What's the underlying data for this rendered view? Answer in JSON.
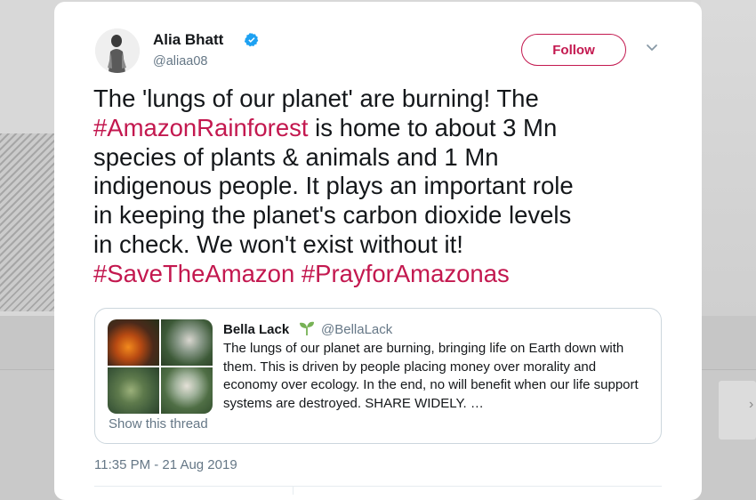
{
  "tweet": {
    "author_name": "Alia Bhatt",
    "author_handle": "@aliaa08",
    "follow_label": "Follow",
    "text_parts": [
      {
        "text": "The 'lungs of our planet' are burning! The\n",
        "type": "text"
      },
      {
        "text": "#AmazonRainforest",
        "type": "hashtag"
      },
      {
        "text": " is home to about 3 Mn\nspecies of plants & animals and 1 Mn\nindigenous people. It plays an important role\nin keeping the planet's carbon dioxide levels\nin check. We won't exist without it!\n",
        "type": "text"
      },
      {
        "text": "#SaveTheAmazon",
        "type": "hashtag"
      },
      {
        "text": " ",
        "type": "text"
      },
      {
        "text": "#PrayforAmazonas",
        "type": "hashtag"
      }
    ],
    "timestamp": "11:35 PM - 21 Aug 2019"
  },
  "quoted": {
    "author_name": "Bella Lack",
    "author_handle": "@BellaLack",
    "text": "The lungs of our planet are burning, bringing life on Earth down with them. This is driven by people placing money over morality and economy over ecology. In the end, no will benefit when our life support systems are destroyed. SHARE WIDELY. …",
    "show_thread_label": "Show this thread"
  },
  "icons": {
    "verified": "verified-badge-icon",
    "caret": "chevron-down-icon",
    "sprout": "seedling-icon"
  },
  "colors": {
    "accent": "#c3184f",
    "verified": "#1da1f2",
    "sprout": "#77b255",
    "secondary_text": "#657786"
  }
}
